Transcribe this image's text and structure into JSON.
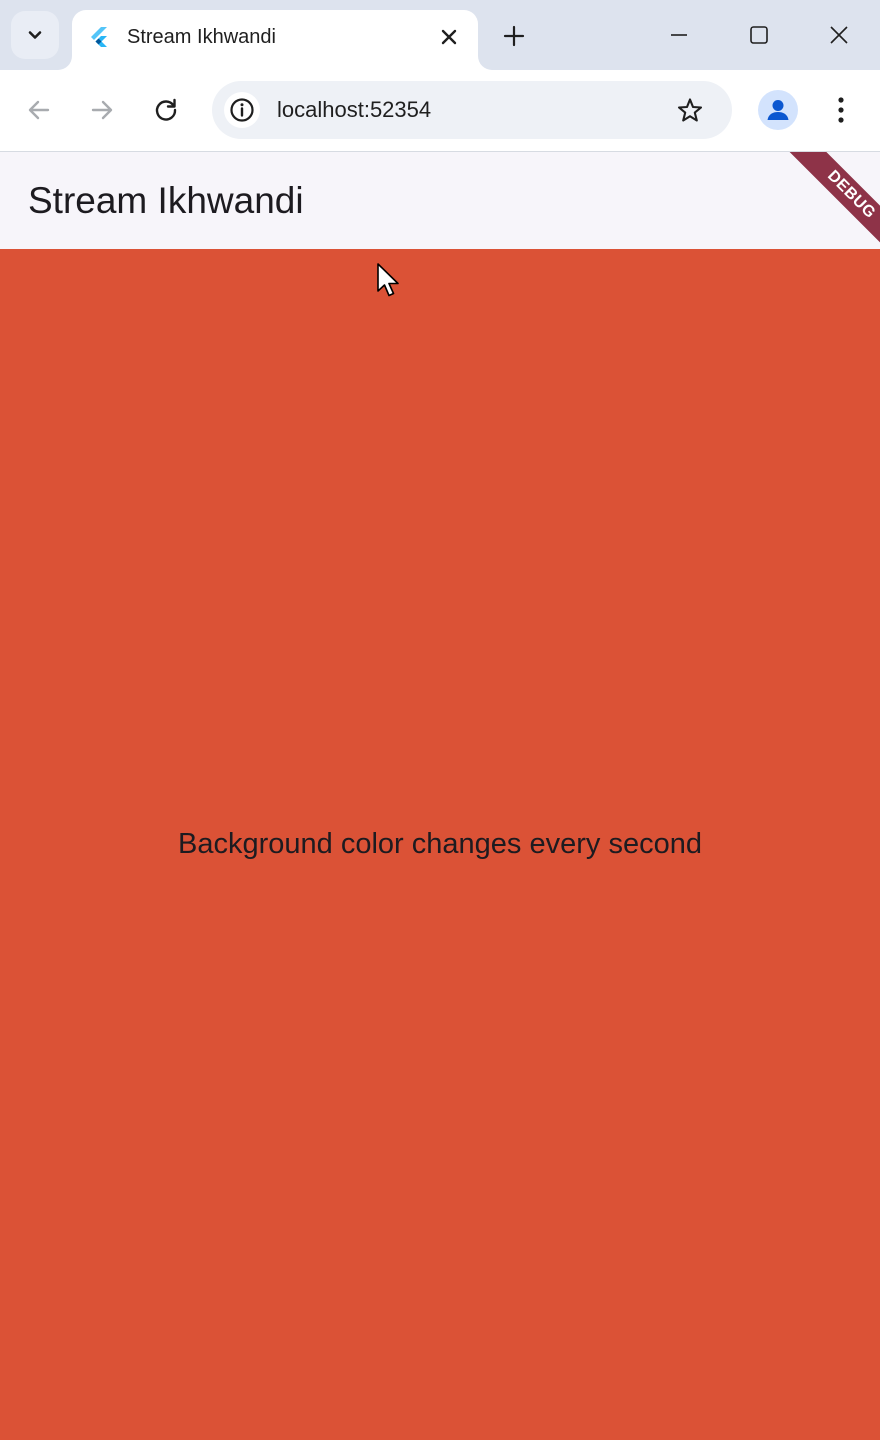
{
  "browser": {
    "tab": {
      "title": "Stream Ikhwandi",
      "favicon": "flutter-logo-icon"
    },
    "address_bar": {
      "url": "localhost:52354"
    },
    "icons": {
      "tab_search": "chevron-down-icon",
      "tab_close": "close-icon",
      "new_tab": "plus-icon",
      "minimize": "minimize-icon",
      "maximize": "maximize-icon",
      "window_close": "close-icon",
      "back": "arrow-left-icon",
      "forward": "arrow-right-icon",
      "reload": "reload-icon",
      "site_info": "info-icon",
      "bookmark": "star-icon",
      "profile": "person-icon",
      "menu": "more-vertical-icon"
    }
  },
  "app": {
    "title": "Stream Ikhwandi",
    "debug_banner": "DEBUG",
    "body_text": "Background color changes every second",
    "background_color": "#db5236",
    "app_bar_color": "#f7f5fa",
    "debug_banner_color": "#8e3348"
  },
  "colors": {
    "tab_strip": "#dde3ee",
    "toolbar": "#ffffff",
    "omnibox": "#eef1f6",
    "profile_accent": "#0b57d0"
  }
}
